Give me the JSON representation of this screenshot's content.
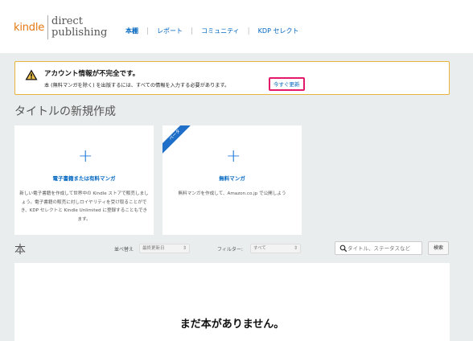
{
  "header": {
    "logo_kindle": "kindle",
    "logo_direct": "direct",
    "logo_publishing": "publishing",
    "nav": [
      {
        "label": "本棚",
        "active": true
      },
      {
        "label": "レポート"
      },
      {
        "label": "コミュニティ"
      },
      {
        "label": "KDP セレクト"
      }
    ]
  },
  "alert": {
    "icon": "warning-icon",
    "title": "アカウント情報が不完全です。",
    "body": "本 (無料マンガを除く) を出版するには、すべての情報を入力する必要があります。",
    "link": "今すぐ更新",
    "border_color": "#e6b43c",
    "highlight_color": "#e4196a"
  },
  "create": {
    "title": "タイトルの新規作成",
    "cards": [
      {
        "title": "電子書籍または有料マンガ",
        "description": "新しい電子書籍を作成して世界中の Kindle ストアで販売しましょう。電子書籍の販売に対しロイヤリティを受け取ることができ、KDP セレクトと Kindle Unlimited に登録することもできます。"
      },
      {
        "ribbon": "ベータ",
        "title": "無料マンガ",
        "description": "無料マンガを作成して、Amazon.co.jp で公開しよう"
      }
    ]
  },
  "books": {
    "label": "本",
    "sort_label": "並べ替え",
    "sort_value": "最終更新日",
    "filter_label": "フィルター:",
    "filter_value": "すべて",
    "search_placeholder": "タイトル、ステータスなど",
    "search_button": "検索",
    "empty_message": "まだ本がありません。"
  },
  "colors": {
    "accent": "#0066c0",
    "kindle_orange": "#e47911",
    "ribbon_blue": "#1f6fc8",
    "background": "#eaeded"
  }
}
